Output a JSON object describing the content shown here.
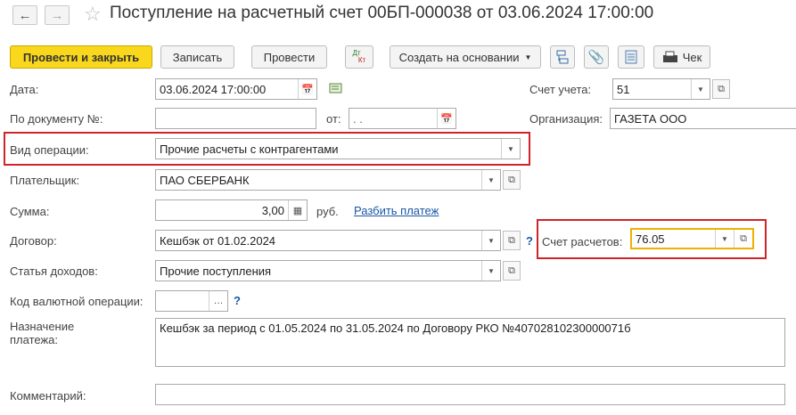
{
  "header": {
    "title": "Поступление на расчетный счет 00БП-000038 от 03.06.2024 17:00:00",
    "back_icon": "arrow-left",
    "forward_icon": "arrow-right",
    "favorite_icon": "star"
  },
  "toolbar": {
    "post_and_close": "Провести и закрыть",
    "save": "Записать",
    "post": "Провести",
    "dtkt_top": "Дт",
    "dtkt_bottom": "Кт",
    "create_based_on": "Создать на основании",
    "receipt": "Чек"
  },
  "form": {
    "date_label": "Дата:",
    "date_value": "03.06.2024 17:00:00",
    "account_label": "Счет учета:",
    "account_value": "51",
    "doc_no_label": "По документу №:",
    "doc_no_value": "",
    "from_label": "от:",
    "from_value": " .  .",
    "org_label": "Организация:",
    "org_value": "ГАЗЕТА ООО",
    "operation_label": "Вид операции:",
    "operation_value": "Прочие расчеты с контрагентами",
    "payer_label": "Плательщик:",
    "payer_value": "ПАО СБЕРБАНК",
    "sum_label": "Сумма:",
    "sum_value": "3,00",
    "currency": "руб.",
    "split_payment": "Разбить платеж",
    "contract_label": "Договор:",
    "contract_value": "Кешбэк от 01.02.2024",
    "settlement_label": "Счет расчетов:",
    "settlement_value": "76.05",
    "income_label": "Статья доходов:",
    "income_value": "Прочие поступления",
    "currency_op_label": "Код валютной операции:",
    "currency_op_value": "",
    "purpose_label_1": "Назначение",
    "purpose_label_2": "платежа:",
    "purpose_value": "Кешбэк за период с 01.05.2024 по 31.05.2024 по Договору РКО №40702810230000071б",
    "comment_label": "Комментарий:",
    "comment_value": "",
    "help_mark": "?"
  },
  "colors": {
    "primary_button": "#f9d71c",
    "highlight_red": "#d0242b",
    "focus_orange": "#f0b000",
    "link": "#1a56a6"
  }
}
